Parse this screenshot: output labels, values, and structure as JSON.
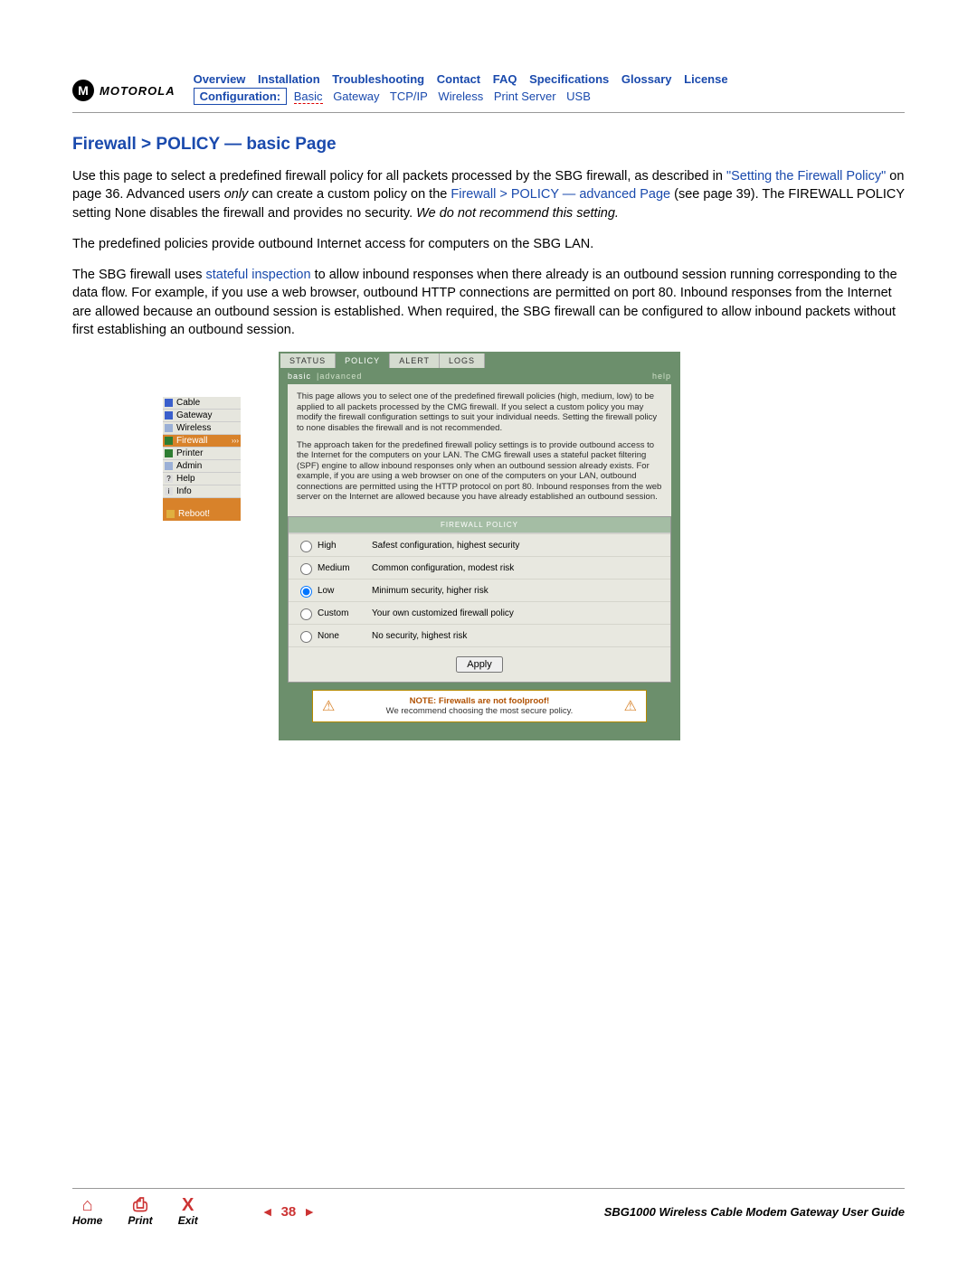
{
  "header": {
    "brand": "MOTOROLA",
    "nav1": [
      "Overview",
      "Installation",
      "Troubleshooting",
      "Contact",
      "FAQ",
      "Specifications",
      "Glossary",
      "License"
    ],
    "config_label": "Configuration:",
    "nav2": [
      "Basic",
      "Gateway",
      "TCP/IP",
      "Wireless",
      "Print Server",
      "USB"
    ]
  },
  "title": "Firewall > POLICY — basic Page",
  "para1_a": "Use this page to select a predefined firewall policy for all packets processed by the SBG firewall, as described in ",
  "para1_link1": "\"Setting the Firewall Policy\"",
  "para1_b": " on page 36. Advanced users ",
  "para1_italic1": "only",
  "para1_c": " can create a custom policy on the ",
  "para1_link2": "Firewall > POLICY — advanced Page",
  "para1_d": " (see page 39). The FIREWALL POLICY setting None disables the firewall and provides no security. ",
  "para1_italic2": "We do not recommend this setting.",
  "para2": "The predefined policies provide outbound Internet access for computers on the SBG LAN.",
  "para3_a": "The SBG firewall uses ",
  "para3_link": "stateful inspection",
  "para3_b": " to allow inbound responses when there already is an outbound session running corresponding to the data flow. For example, if you use a web browser, outbound HTTP connections are permitted on port 80. Inbound responses from the Internet are allowed because an outbound session is established. When required, the SBG firewall can be configured to allow inbound packets without first establishing an outbound session.",
  "sidebar": {
    "items": [
      "Cable",
      "Gateway",
      "Wireless",
      "Firewall",
      "Printer",
      "Admin",
      "Help",
      "Info"
    ],
    "active_index": 3,
    "reboot": "Reboot!"
  },
  "tabs": [
    "STATUS",
    "POLICY",
    "ALERT",
    "LOGS"
  ],
  "tabs_active": 1,
  "subtabs": {
    "basic": "basic",
    "advanced": "advanced",
    "help": "help"
  },
  "desc1": "This page allows you to select one of the predefined firewall policies (high, medium, low) to be applied to all packets processed by the CMG firewall. If you select a custom policy you may modify the firewall configuration settings to suit your individual needs. Setting the firewall policy to none disables the firewall and is not recommended.",
  "desc2": "The approach taken for the predefined firewall policy settings is to provide outbound access to the Internet for the computers on your LAN. The CMG firewall uses a stateful packet filtering (SPF) engine to allow inbound responses only when an outbound session already exists. For example, if you are using a web browser on one of the computers on your LAN, outbound connections are permitted using the HTTP protocol on port 80. Inbound responses from the web server on the Internet are allowed because you have already established an outbound session.",
  "table_title": "FIREWALL POLICY",
  "options": [
    {
      "label": "High",
      "desc": "Safest configuration, highest security"
    },
    {
      "label": "Medium",
      "desc": "Common configuration, modest risk"
    },
    {
      "label": "Low",
      "desc": "Minimum security, higher risk"
    },
    {
      "label": "Custom",
      "desc": "Your own customized firewall policy"
    },
    {
      "label": "None",
      "desc": "No security, highest risk"
    }
  ],
  "selected_option": 2,
  "apply": "Apply",
  "note_bold": "NOTE: Firewalls are not foolproof!",
  "note_text": "We recommend choosing the most secure policy.",
  "footer": {
    "home": "Home",
    "print": "Print",
    "exit": "Exit",
    "page": "38",
    "guide": "SBG1000 Wireless Cable Modem Gateway User Guide"
  }
}
